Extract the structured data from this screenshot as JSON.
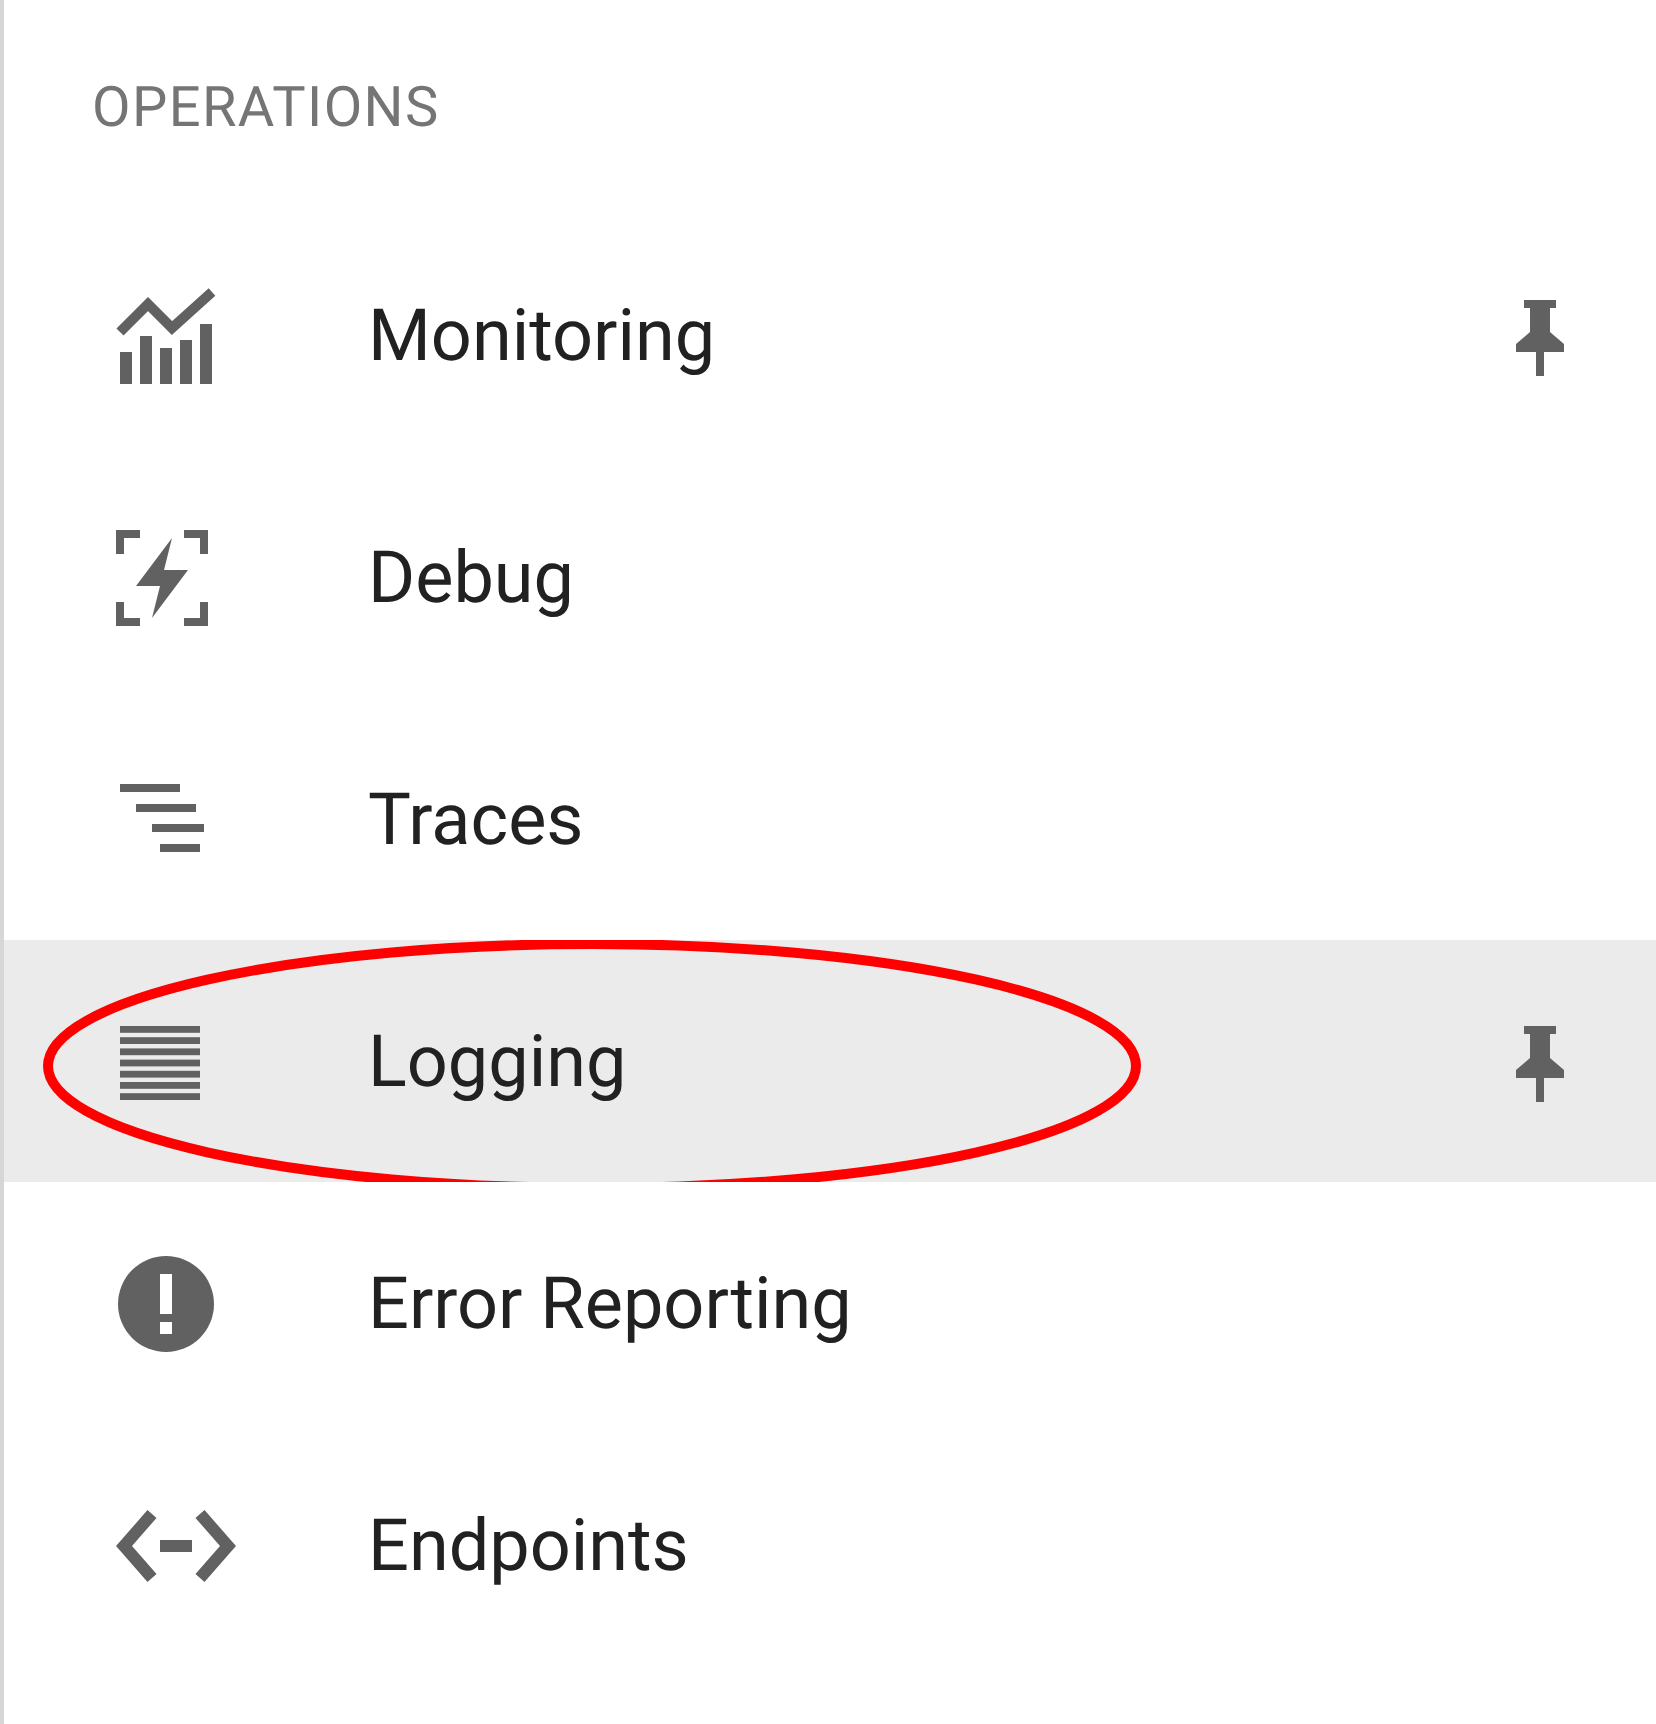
{
  "section": {
    "title": "OPERATIONS"
  },
  "items": [
    {
      "label": "Monitoring",
      "pinned": true,
      "selected": false,
      "circled": false
    },
    {
      "label": "Debug",
      "pinned": false,
      "selected": false,
      "circled": false
    },
    {
      "label": "Traces",
      "pinned": false,
      "selected": false,
      "circled": false
    },
    {
      "label": "Logging",
      "pinned": true,
      "selected": true,
      "circled": true
    },
    {
      "label": "Error Reporting",
      "pinned": false,
      "selected": false,
      "circled": false
    },
    {
      "label": "Endpoints",
      "pinned": false,
      "selected": false,
      "circled": false
    }
  ]
}
